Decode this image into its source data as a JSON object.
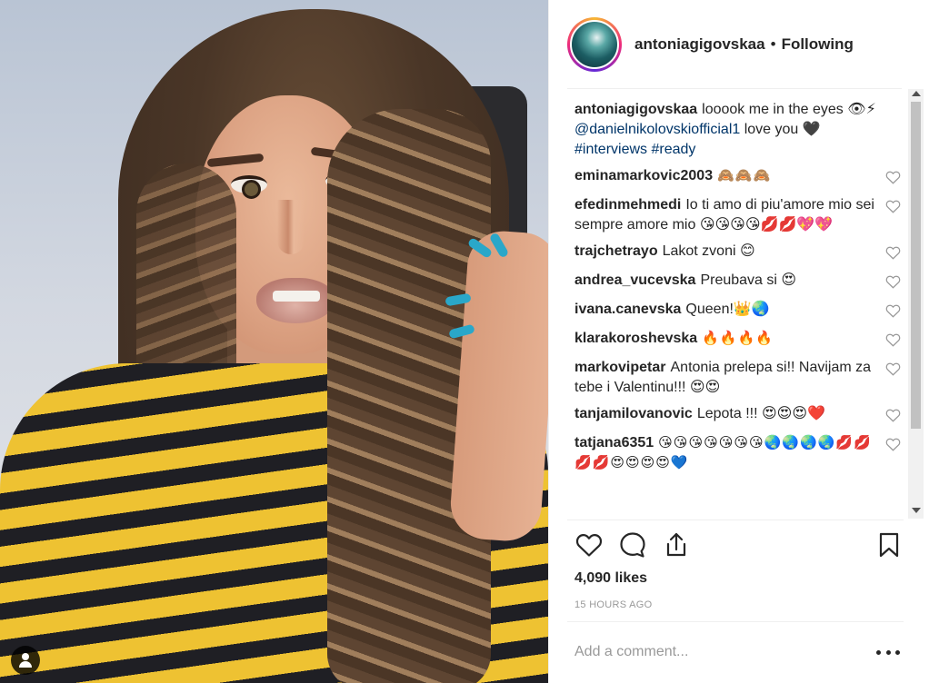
{
  "post": {
    "image_description": "",
    "username": "antoniagigovskaa",
    "separator": "•",
    "follow_status": "Following",
    "caption_user": "antoniagigovskaa",
    "caption_text": "looook me in the eyes 👁⚡",
    "caption_mention": "@danielnikolovskiofficial1",
    "caption_after_mention": " love you 🖤",
    "caption_hashtags": "#interviews #ready"
  },
  "comments": [
    {
      "user": "eminamarkovic2003",
      "text": "🙈🙈🙈"
    },
    {
      "user": "efedinmehmedi",
      "text": "Io ti amo di piu'amore mio sei sempre amore mio 😘😘😘😘💋💋💖💖"
    },
    {
      "user": "trajchetrayo",
      "text": "Lakot zvoni 😊"
    },
    {
      "user": "andrea_vucevska",
      "text": "Preubava si 😍"
    },
    {
      "user": "ivana.canevska",
      "text": "Queen!👑🌏"
    },
    {
      "user": "klarakoroshevska",
      "text": "🔥🔥🔥🔥"
    },
    {
      "user": "markovipetar",
      "text": "Antonia prelepa si!! Navijam za tebe i Valentinu!!! 😍😍"
    },
    {
      "user": "tanjamilovanovic",
      "text": "Lepota !!! 😍😍😍❤️"
    },
    {
      "user": "tatjana6351",
      "text": "😘😘😘😘😘😘😘🌏🌏🌏🌏💋💋💋💋😍😍😍😍💙"
    }
  ],
  "actions": {
    "like_icon": "heart-outline-icon",
    "comment_icon": "speech-bubble-icon",
    "share_icon": "share-arrow-icon",
    "save_icon": "bookmark-icon"
  },
  "likes": "4,090 likes",
  "timestamp": "15 HOURS AGO",
  "add_comment_placeholder": "Add a comment...",
  "colors": {
    "text": "#262626",
    "mention": "#003569",
    "muted": "#999999",
    "divider": "#efefef"
  }
}
